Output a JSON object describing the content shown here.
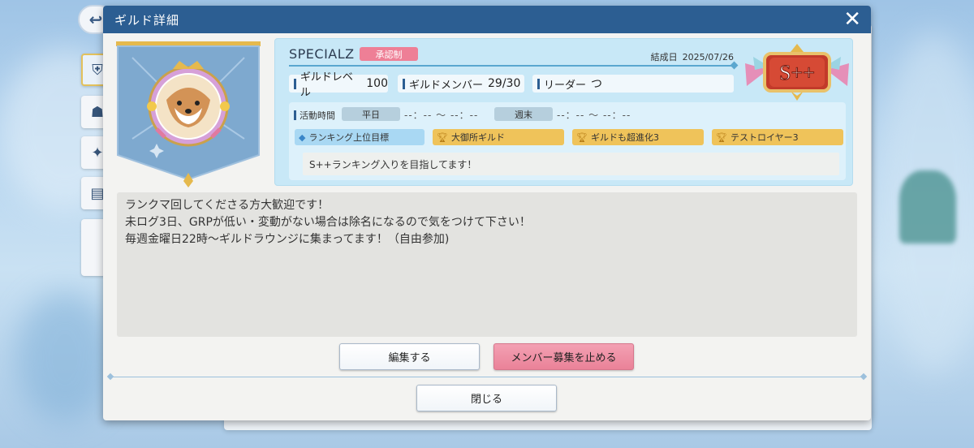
{
  "dialog": {
    "title": "ギルド詳細",
    "close_icon": "close-icon"
  },
  "guild": {
    "name": "SPECIALZ",
    "approval_badge": "承認制",
    "founded_label": "結成日",
    "founded_date": "2025/07/26",
    "rank": "S++",
    "stats": [
      {
        "label": "ギルドレベル",
        "value": "100"
      },
      {
        "label": "ギルドメンバー",
        "value": "29/30"
      },
      {
        "label": "リーダー",
        "value": "つ"
      }
    ],
    "activity": {
      "label": "活動時間",
      "weekday_label": "平日",
      "weekday_time": "--：-- 〜 --：--",
      "weekend_label": "週末",
      "weekend_time": "--：-- 〜 --：--"
    },
    "tags": [
      {
        "label": "ランキング上位目標",
        "color": "#a9d8f3",
        "icon": "tag-icon"
      },
      {
        "label": "大御所ギルド",
        "color": "#efc35a",
        "icon": "trophy-icon"
      },
      {
        "label": "ギルドも超進化3",
        "color": "#efc35a",
        "icon": "trophy-icon"
      },
      {
        "label": "テストロイヤー3",
        "color": "#efc35a",
        "icon": "trophy-icon"
      }
    ],
    "motto": "S++ランキング入りを目指してます！",
    "description": [
      "ランクマ回してくださる方大歓迎です！",
      "未ログ3日、GRPが低い・変動がない場合は除名になるので気をつけて下さい！",
      "毎週金曜日22時〜ギルドラウンジに集まってます！（自由参加)"
    ]
  },
  "buttons": {
    "edit": "編集する",
    "stop_recruit": "メンバー募集を止める",
    "close": "閉じる"
  },
  "colors": {
    "header": "#2c5e92",
    "badge_pink": "#ee7f96",
    "card_blue": "#c8e8f7",
    "gold": "#efc35a"
  }
}
